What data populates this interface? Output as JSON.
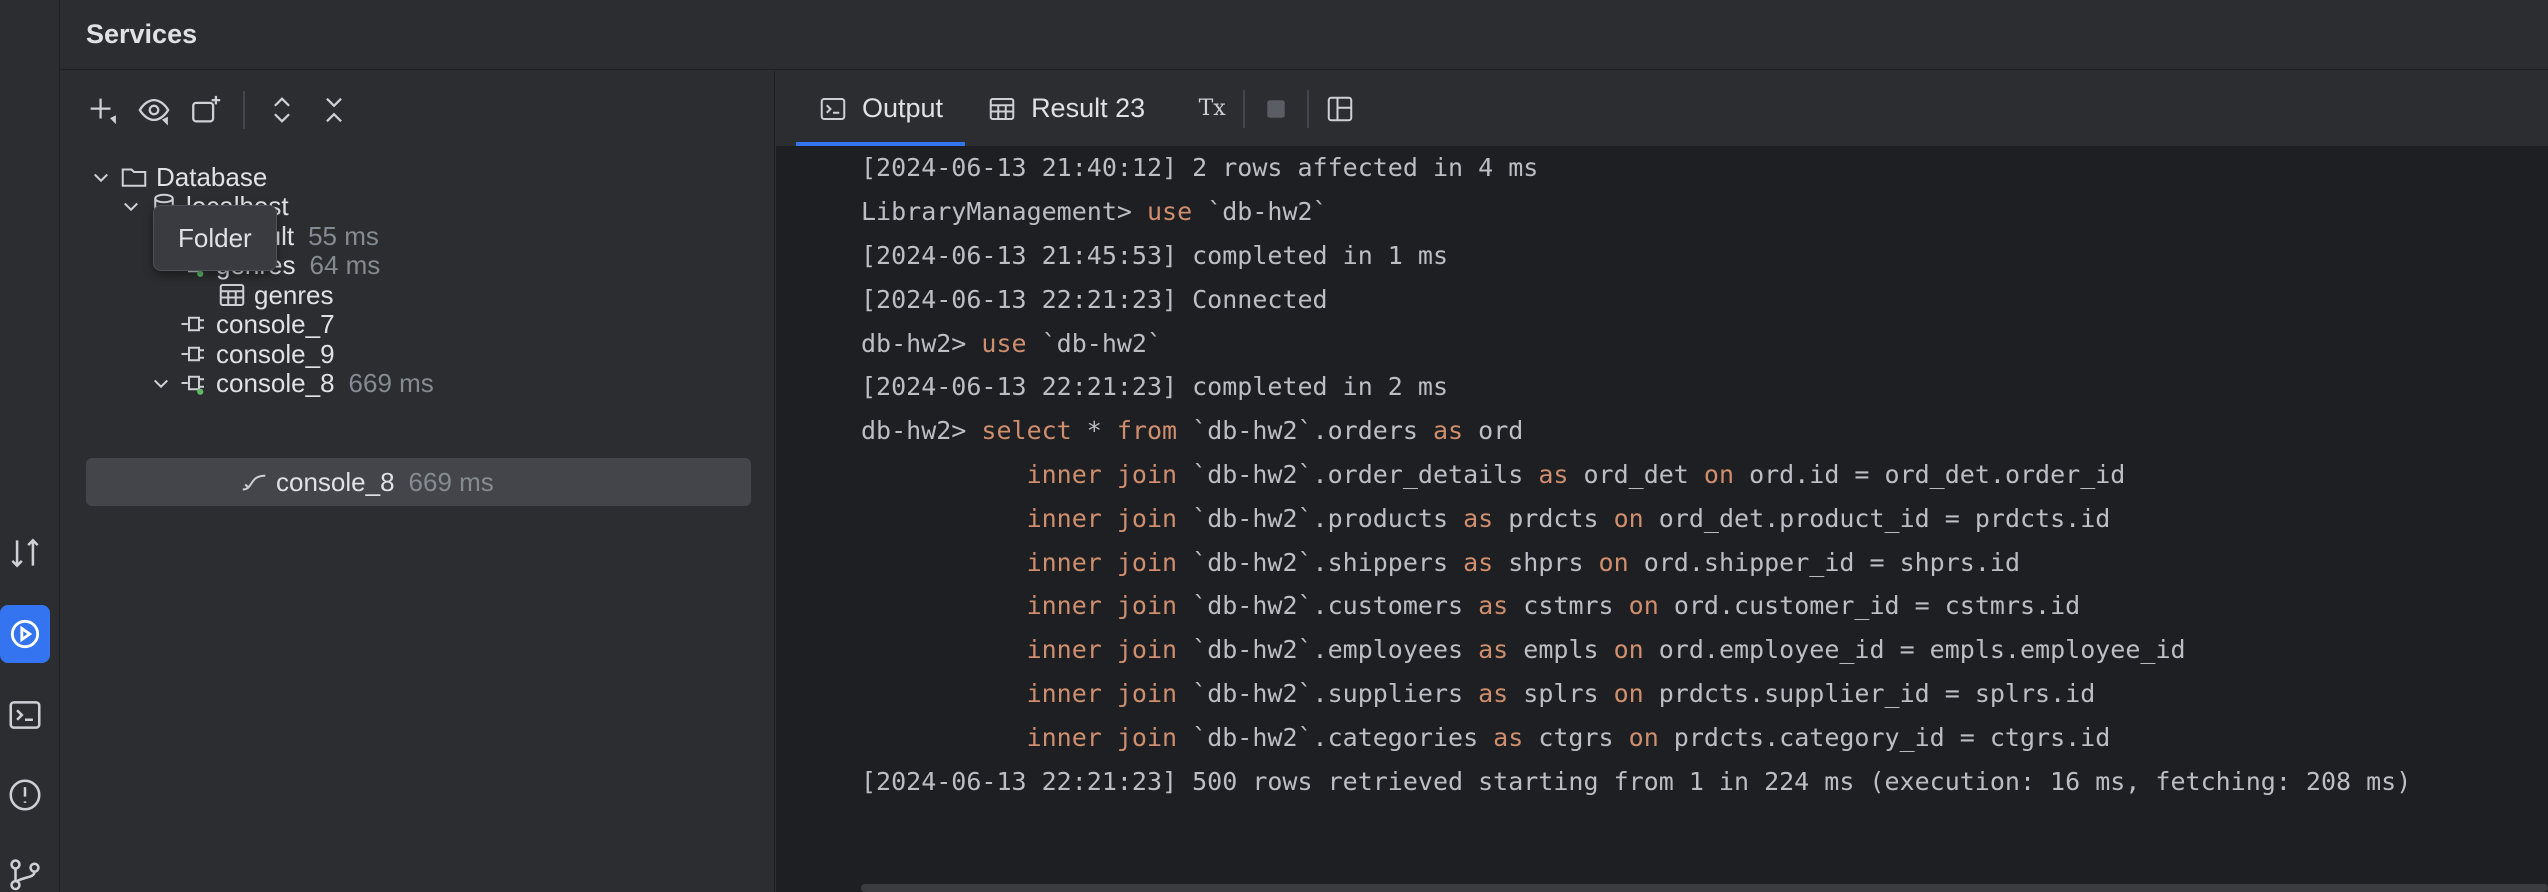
{
  "colors": {
    "accent": "#3574f0",
    "keyword": "#cf8e6d",
    "running_dot": "#5fb865",
    "timing": "#868a91"
  },
  "sidebar_strip": {
    "icons": [
      "pull-requests-icon",
      "services-icon",
      "terminal-icon",
      "problems-icon",
      "git-icon"
    ]
  },
  "title": "Services",
  "toolbar": {
    "icons": [
      "add-icon",
      "view-options-icon",
      "new-service-icon",
      "expand-all-icon",
      "collapse-all-icon"
    ]
  },
  "tree": {
    "database": "Database",
    "localhost": "localhost",
    "default": {
      "label": "default",
      "time": "55 ms"
    },
    "genres_session": {
      "label": "genres",
      "time": "64 ms"
    },
    "genres_table": "genres",
    "console_7": "console_7",
    "console_9": "console_9",
    "console_8": {
      "label": "console_8",
      "time": "669 ms"
    },
    "console_8_child": {
      "label": "console_8",
      "time": "669 ms"
    }
  },
  "tooltip": "Folder",
  "tabs": {
    "output": "Output",
    "result": "Result 23",
    "tx_label": "Tx"
  },
  "console": [
    [
      {
        "t": "[2024-06-13 21:40:12] 2 rows affected in 4 ms",
        "k": false
      }
    ],
    [
      {
        "t": "LibraryManagement> ",
        "k": false
      },
      {
        "t": "use",
        "k": true
      },
      {
        "t": " `db-hw2`",
        "k": false
      }
    ],
    [
      {
        "t": "[2024-06-13 21:45:53] completed in 1 ms",
        "k": false
      }
    ],
    [
      {
        "t": "[2024-06-13 22:21:23] Connected",
        "k": false
      }
    ],
    [
      {
        "t": "db-hw2> ",
        "k": false
      },
      {
        "t": "use",
        "k": true
      },
      {
        "t": " `db-hw2`",
        "k": false
      }
    ],
    [
      {
        "t": "[2024-06-13 22:21:23] completed in 2 ms",
        "k": false
      }
    ],
    [
      {
        "t": "db-hw2> ",
        "k": false
      },
      {
        "t": "select",
        "k": true
      },
      {
        "t": " * ",
        "k": false
      },
      {
        "t": "from",
        "k": true
      },
      {
        "t": " `db-hw2`.orders ",
        "k": false
      },
      {
        "t": "as",
        "k": true
      },
      {
        "t": " ord",
        "k": false
      }
    ],
    [
      {
        "t": "           ",
        "k": false
      },
      {
        "t": "inner join",
        "k": true
      },
      {
        "t": " `db-hw2`.order_details ",
        "k": false
      },
      {
        "t": "as",
        "k": true
      },
      {
        "t": " ord_det ",
        "k": false
      },
      {
        "t": "on",
        "k": true
      },
      {
        "t": " ord.id = ord_det.order_id",
        "k": false
      }
    ],
    [
      {
        "t": "           ",
        "k": false
      },
      {
        "t": "inner join",
        "k": true
      },
      {
        "t": " `db-hw2`.products ",
        "k": false
      },
      {
        "t": "as",
        "k": true
      },
      {
        "t": " prdcts ",
        "k": false
      },
      {
        "t": "on",
        "k": true
      },
      {
        "t": " ord_det.product_id = prdcts.id",
        "k": false
      }
    ],
    [
      {
        "t": "           ",
        "k": false
      },
      {
        "t": "inner join",
        "k": true
      },
      {
        "t": " `db-hw2`.shippers ",
        "k": false
      },
      {
        "t": "as",
        "k": true
      },
      {
        "t": " shprs ",
        "k": false
      },
      {
        "t": "on",
        "k": true
      },
      {
        "t": " ord.shipper_id = shprs.id",
        "k": false
      }
    ],
    [
      {
        "t": "           ",
        "k": false
      },
      {
        "t": "inner join",
        "k": true
      },
      {
        "t": " `db-hw2`.customers ",
        "k": false
      },
      {
        "t": "as",
        "k": true
      },
      {
        "t": " cstmrs ",
        "k": false
      },
      {
        "t": "on",
        "k": true
      },
      {
        "t": " ord.customer_id = cstmrs.id",
        "k": false
      }
    ],
    [
      {
        "t": "           ",
        "k": false
      },
      {
        "t": "inner join",
        "k": true
      },
      {
        "t": " `db-hw2`.employees ",
        "k": false
      },
      {
        "t": "as",
        "k": true
      },
      {
        "t": " empls ",
        "k": false
      },
      {
        "t": "on",
        "k": true
      },
      {
        "t": " ord.employee_id = empls.employee_id",
        "k": false
      }
    ],
    [
      {
        "t": "           ",
        "k": false
      },
      {
        "t": "inner join",
        "k": true
      },
      {
        "t": " `db-hw2`.suppliers ",
        "k": false
      },
      {
        "t": "as",
        "k": true
      },
      {
        "t": " splrs ",
        "k": false
      },
      {
        "t": "on",
        "k": true
      },
      {
        "t": " prdcts.supplier_id = splrs.id",
        "k": false
      }
    ],
    [
      {
        "t": "           ",
        "k": false
      },
      {
        "t": "inner join",
        "k": true
      },
      {
        "t": " `db-hw2`.categories ",
        "k": false
      },
      {
        "t": "as",
        "k": true
      },
      {
        "t": " ctgrs ",
        "k": false
      },
      {
        "t": "on",
        "k": true
      },
      {
        "t": " prdcts.category_id = ctgrs.id",
        "k": false
      }
    ],
    [
      {
        "t": "[2024-06-13 22:21:23] 500 rows retrieved starting from 1 in 224 ms (execution: 16 ms, fetching: 208 ms)",
        "k": false
      }
    ]
  ]
}
